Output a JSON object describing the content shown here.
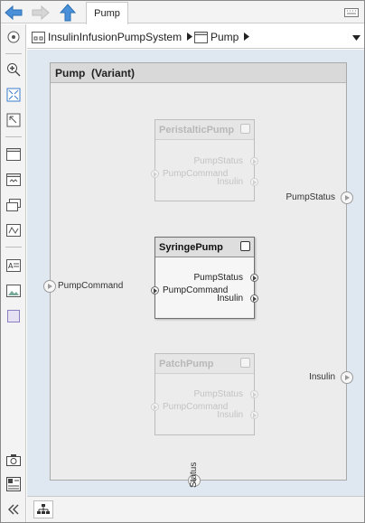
{
  "toolbar": {
    "back_icon": "back-arrow-icon",
    "forward_icon": "forward-arrow-icon",
    "up_icon": "up-arrow-icon",
    "tab_label": "Pump",
    "keyboard_icon": "keyboard-icon"
  },
  "breadcrumb": {
    "items": [
      {
        "label": "InsulinInfusionPumpSystem",
        "icon": "model-icon"
      },
      {
        "label": "Pump",
        "icon": "subsystem-icon"
      }
    ]
  },
  "palette": {
    "tools": [
      "navigate-icon",
      "zoom-in-icon",
      "fit-to-view-icon",
      "zoom-normal-icon",
      "component-icon",
      "reference-component-icon",
      "variant-component-icon",
      "adapter-icon",
      "annotation-icon",
      "image-icon",
      "area-icon",
      "snapshot-icon",
      "report-icon",
      "collapse-icon"
    ]
  },
  "canvas": {
    "variant_title": "Pump  (Variant)",
    "blocks": [
      {
        "name": "PeristalticPump",
        "active": false,
        "outputs": [
          "PumpStatus",
          "Insulin"
        ],
        "inputs": [
          "PumpCommand"
        ]
      },
      {
        "name": "SyringePump",
        "active": true,
        "outputs": [
          "PumpStatus",
          "Insulin"
        ],
        "inputs": [
          "PumpCommand"
        ]
      },
      {
        "name": "PatchPump",
        "active": false,
        "outputs": [
          "PumpStatus",
          "Insulin"
        ],
        "inputs": [
          "PumpCommand"
        ]
      }
    ],
    "external_ports": {
      "input": "PumpCommand",
      "output_status": "PumpStatus",
      "output_insulin": "Insulin",
      "bottom": "Status"
    }
  },
  "statusbar": {
    "hierarchy_icon": "hierarchy-icon"
  },
  "colors": {
    "accent_arrow": "#4a90d9",
    "canvas_bg": "#dfe7f1"
  }
}
